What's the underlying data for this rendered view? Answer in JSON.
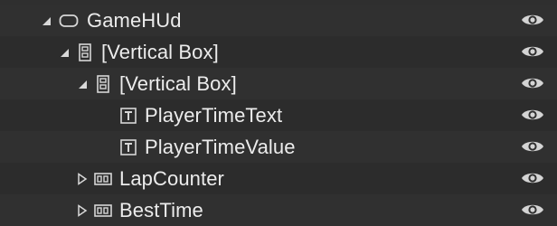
{
  "hierarchy": {
    "rows": [
      {
        "label": "GameHUd",
        "arrow": "expanded",
        "icon": "canvas-panel-icon"
      },
      {
        "label": "[Vertical Box]",
        "arrow": "expanded",
        "icon": "vertical-box-icon"
      },
      {
        "label": "[Vertical Box]",
        "arrow": "expanded",
        "icon": "vertical-box-icon"
      },
      {
        "label": "PlayerTimeText",
        "arrow": "none",
        "icon": "text-block-icon"
      },
      {
        "label": "PlayerTimeValue",
        "arrow": "none",
        "icon": "text-block-icon"
      },
      {
        "label": "LapCounter",
        "arrow": "collapsed",
        "icon": "horizontal-box-icon"
      },
      {
        "label": "BestTime",
        "arrow": "collapsed",
        "icon": "horizontal-box-icon"
      }
    ]
  },
  "colors": {
    "background": "#2f2f2f",
    "text": "#ececec",
    "icon": "#d6d6d6"
  }
}
